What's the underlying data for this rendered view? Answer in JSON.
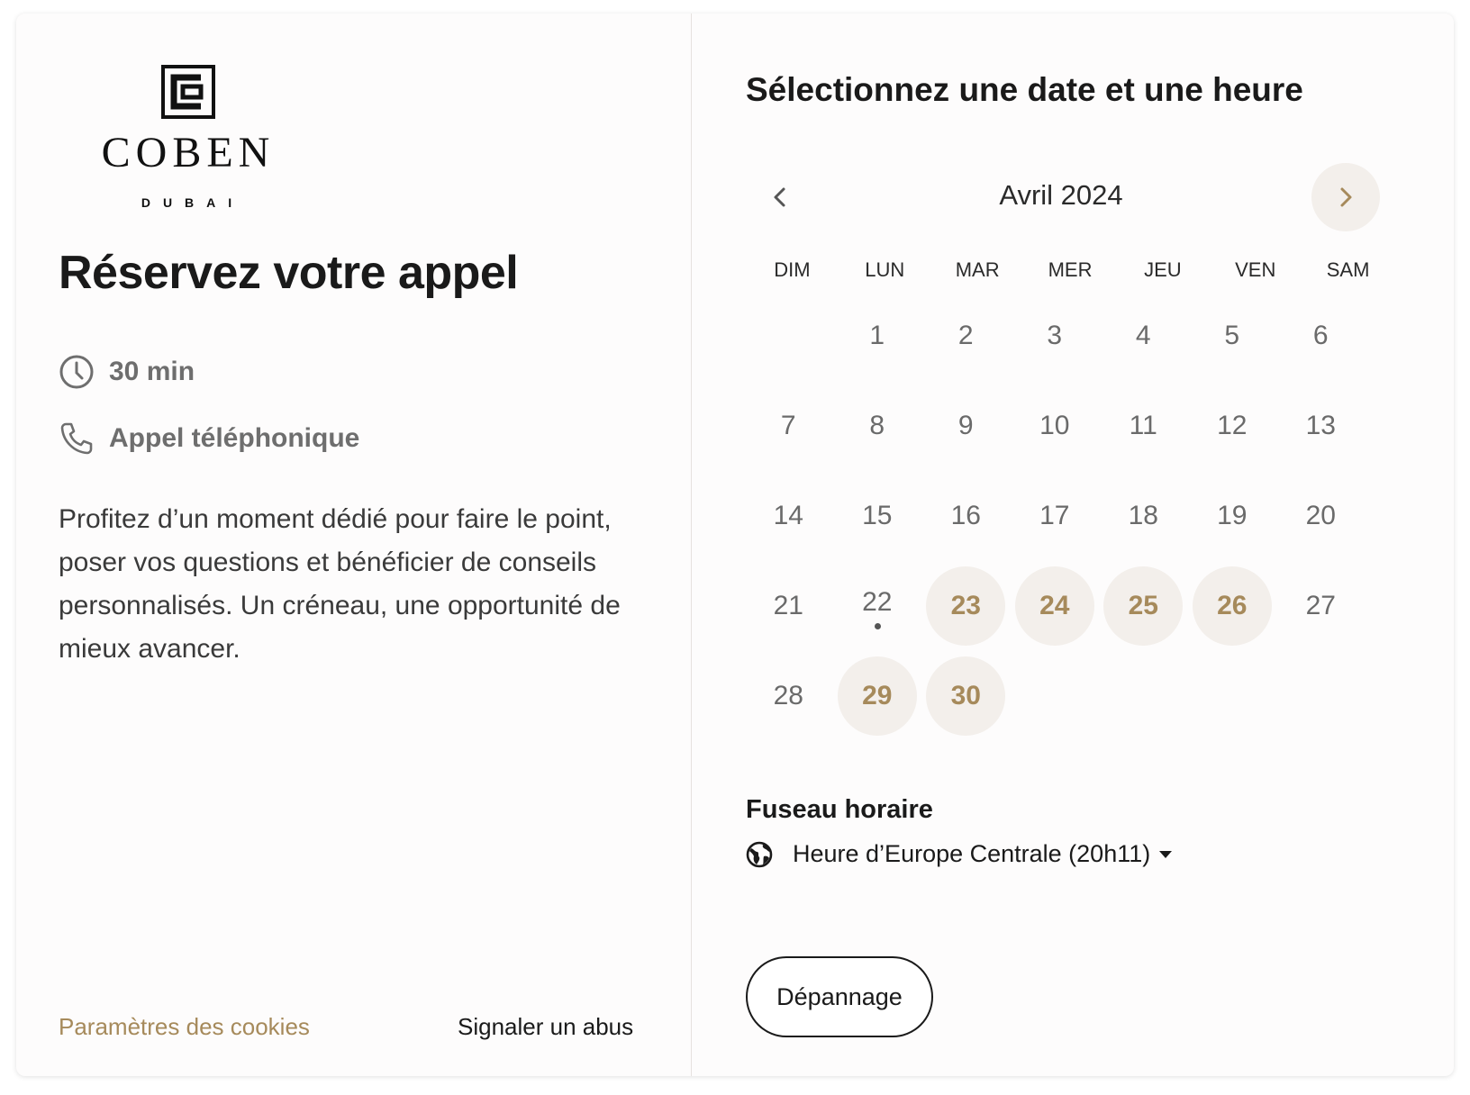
{
  "brand": {
    "logo_name": "COBEN",
    "logo_sub": "DUBAI"
  },
  "event": {
    "title": "Réservez votre appel",
    "duration": "30 min",
    "duration_icon": "clock-icon",
    "type": "Appel téléphonique",
    "type_icon": "phone-icon",
    "description": "Profitez d’un moment dédié pour faire le point, poser vos questions et bénéficier de conseils personnalisés. Un créneau, une opportunité de mieux avancer."
  },
  "footer": {
    "cookies": "Paramètres des cookies",
    "abuse": "Signaler un abus"
  },
  "scheduler": {
    "title": "Sélectionnez une date et une heure",
    "month": "Avril 2024",
    "weekdays": [
      "DIM",
      "LUN",
      "MAR",
      "MER",
      "JEU",
      "VEN",
      "SAM"
    ],
    "first_weekday_index": 1,
    "days_in_month": 30,
    "available_days": [
      23,
      24,
      25,
      26,
      29,
      30
    ],
    "today": 22
  },
  "timezone": {
    "label": "Fuseau horaire",
    "value": "Heure d’Europe Centrale (20h11)"
  },
  "troubleshoot": {
    "label": "Dépannage"
  },
  "colors": {
    "accent": "#a68a5b",
    "available_bg": "#f3efeb",
    "text": "#1a1a1a",
    "muted": "#6a6a6a"
  }
}
